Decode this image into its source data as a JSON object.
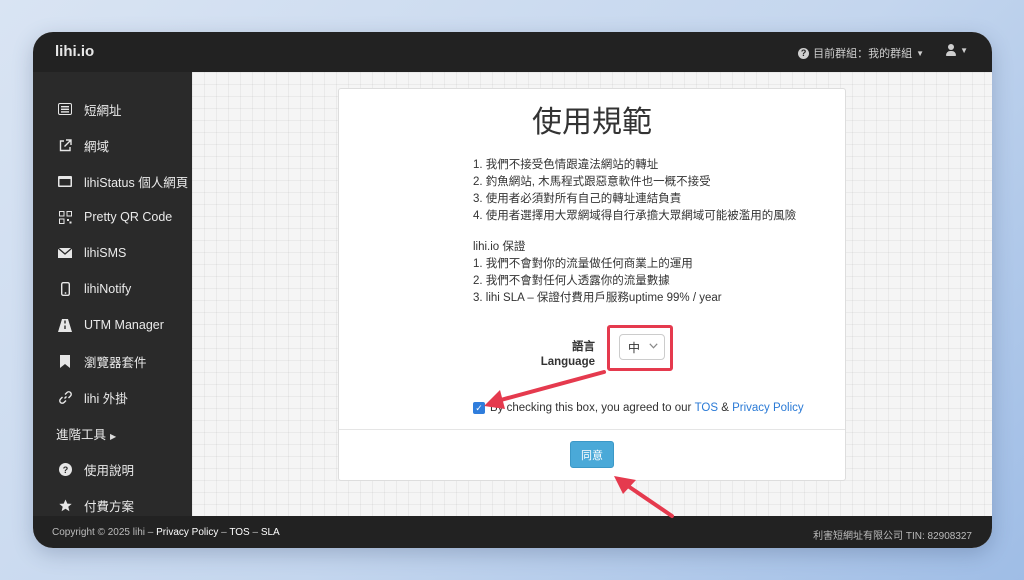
{
  "header": {
    "brand": "lihi.io",
    "group_menu": "目前群組：我的群組"
  },
  "sidebar": {
    "items": [
      {
        "label": "短網址"
      },
      {
        "label": "網域"
      },
      {
        "label": "lihiStatus 個人網頁"
      },
      {
        "label": "Pretty QR Code"
      },
      {
        "label": "lihiSMS"
      },
      {
        "label": "lihiNotify"
      },
      {
        "label": "UTM Manager"
      },
      {
        "label": "瀏覽器套件"
      },
      {
        "label": "lihi 外掛"
      },
      {
        "label": "進階工具"
      },
      {
        "label": "使用說明"
      },
      {
        "label": "付費方案"
      }
    ]
  },
  "card": {
    "title": "使用規範",
    "rules": [
      "1. 我們不接受色情跟違法網站的轉址",
      "2. 釣魚網站, 木馬程式跟惡意軟件也一概不接受",
      "3. 使用者必須對所有自己的轉址連結負責",
      "4. 使用者選擇用大眾網域得自行承擔大眾網域可能被濫用的風險"
    ],
    "guarantee_title": "lihi.io 保證",
    "guarantees": [
      "1. 我們不會對你的流量做任何商業上的運用",
      "2. 我們不會對任何人透露你的流量數據",
      "3. lihi SLA – 保證付費用戶服務uptime 99% / year"
    ],
    "language_label_zh": "語言",
    "language_label_en": "Language",
    "language_value": "中",
    "agree_text": "By checking this box, you agreed to our",
    "tos_link": "TOS",
    "amp": "&",
    "privacy_link": "Privacy Policy",
    "agree_button": "同意"
  },
  "footer": {
    "copyright": "Copyright © 2025 lihi –",
    "privacy": "Privacy Policy",
    "sep1": "–",
    "tos": "TOS",
    "sep2": "–",
    "sla": "SLA",
    "company": "利害短網址有限公司 TIN: 82908327"
  },
  "colors": {
    "accent": "#4aa9d8",
    "annotation": "#e53a4e",
    "link": "#2a7ad6"
  }
}
